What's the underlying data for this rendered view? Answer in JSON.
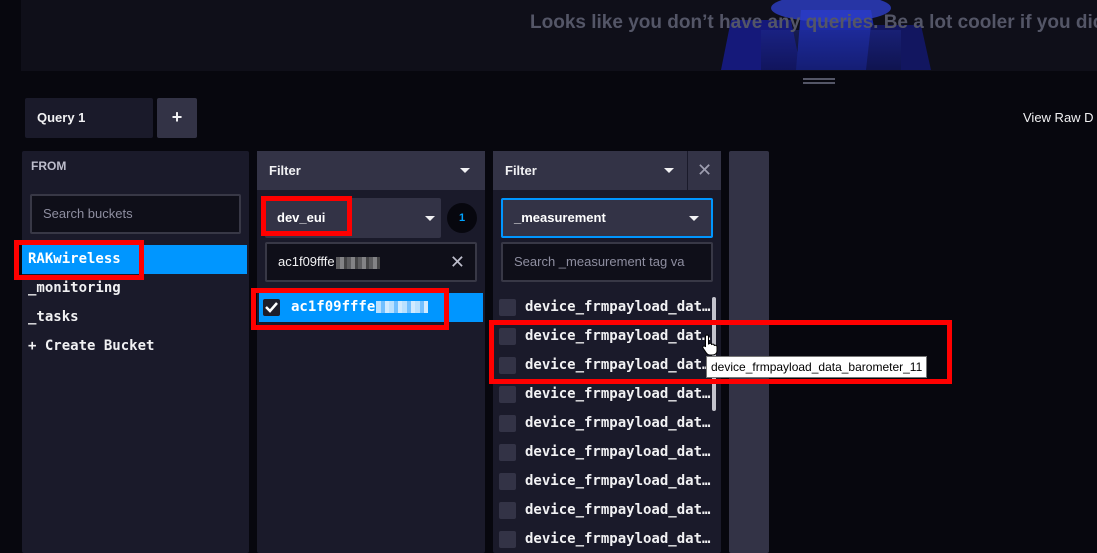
{
  "top": {
    "empty_message": "Looks like you don’t have any queries. Be a lot cooler if you dic"
  },
  "query_bar": {
    "tab_label": "Query 1",
    "add_label": "+",
    "view_raw_label": "View Raw D"
  },
  "from_panel": {
    "label": "FROM",
    "search_placeholder": "Search buckets",
    "buckets": [
      {
        "name": "RAKwireless",
        "selected": true
      },
      {
        "name": "_monitoring",
        "selected": false
      },
      {
        "name": "_tasks",
        "selected": false
      },
      {
        "name": "+ Create Bucket",
        "selected": false
      }
    ]
  },
  "key_filter": {
    "header": "Filter",
    "key": "dev_eui",
    "selected_count": "1",
    "search_value": "ac1f09fffe",
    "value_item": "ac1f09fffe"
  },
  "measurement_filter": {
    "header": "Filter",
    "close_label": "✕",
    "key": "_measurement",
    "search_placeholder": "Search _measurement tag va",
    "items": [
      "device_frmpayload_dat…",
      "device_frmpayload_dat…",
      "device_frmpayload_dat…",
      "device_frmpayload_dat…",
      "device_frmpayload_dat…",
      "device_frmpayload_dat…",
      "device_frmpayload_dat…",
      "device_frmpayload_dat…",
      "device_frmpayload_dat…"
    ]
  },
  "tooltip": {
    "text": "device_frmpayload_data_barometer_11"
  },
  "colors": {
    "accent": "#0096ff",
    "highlight": "#ff0000"
  }
}
